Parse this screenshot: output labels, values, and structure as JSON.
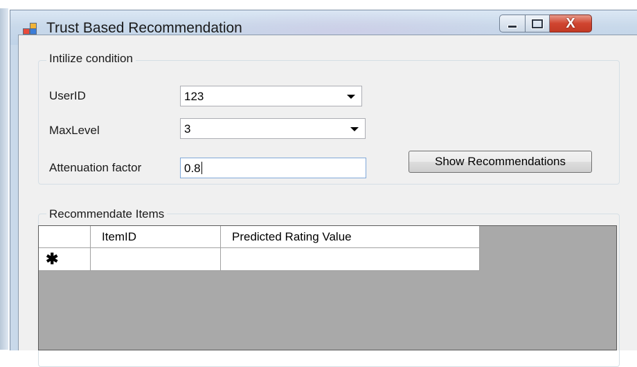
{
  "window": {
    "title": "Trust Based Recommendation",
    "close_glyph": "X"
  },
  "init_group": {
    "legend": "Intilize condition",
    "user_id": {
      "label": "UserID",
      "value": "123"
    },
    "max_level": {
      "label": "MaxLevel",
      "value": "3"
    },
    "attenuation": {
      "label": "Attenuation factor",
      "value": "0.8"
    },
    "show_button": "Show Recommendations"
  },
  "items_group": {
    "legend": "Recommendate Items",
    "columns": [
      "ItemID",
      "Predicted Rating Value"
    ],
    "new_row_marker": "✱"
  }
}
